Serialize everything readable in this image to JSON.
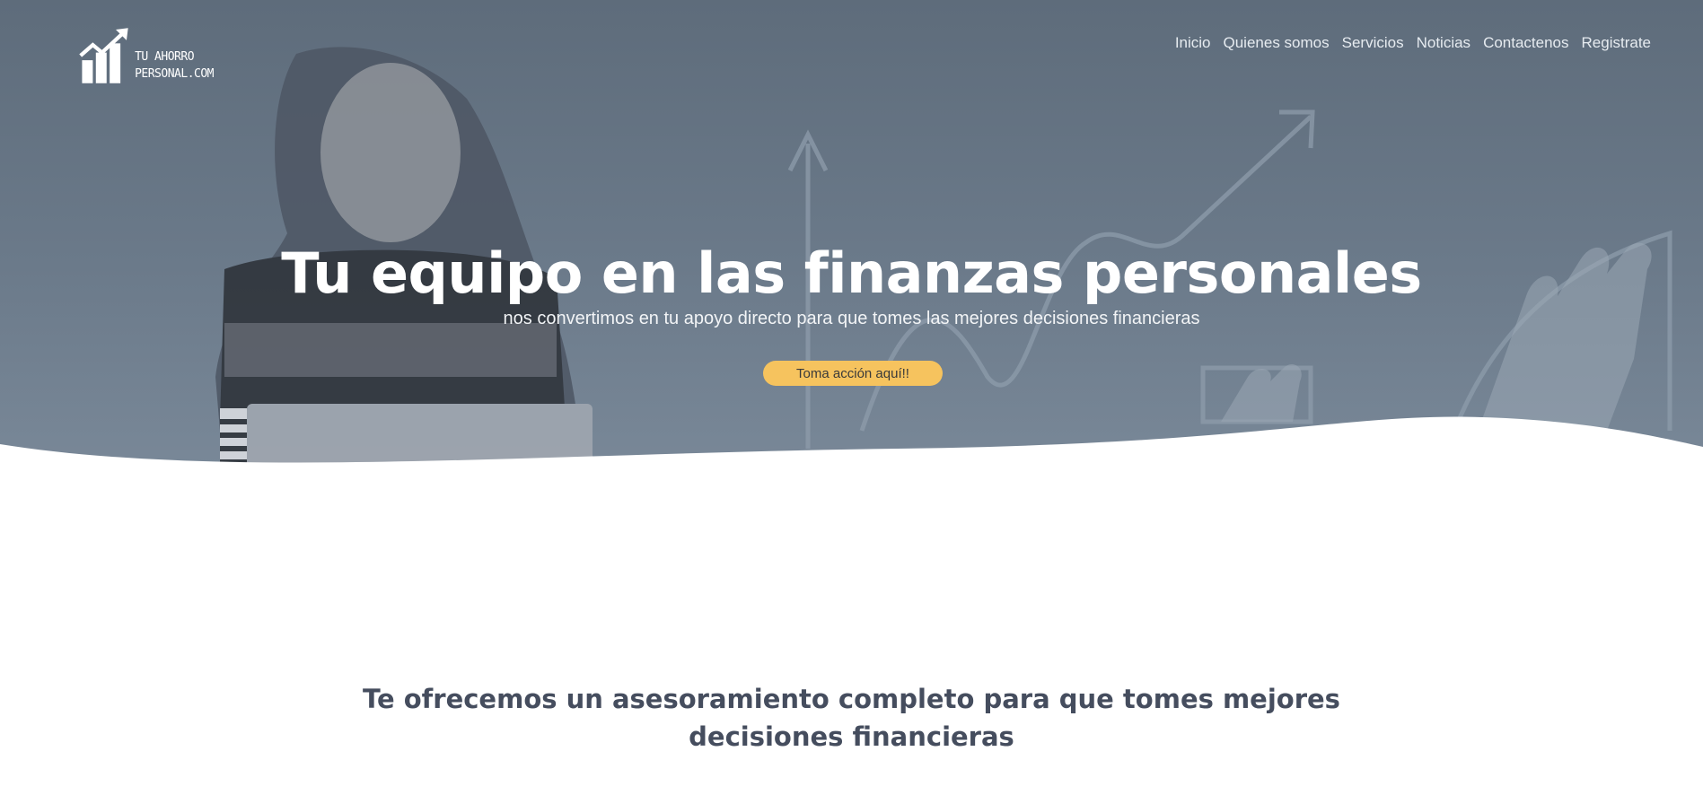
{
  "brand": {
    "logo_line1": "TU AHORRO",
    "logo_line2": "PERSONAL.COM"
  },
  "nav": {
    "items": [
      {
        "label": "Inicio"
      },
      {
        "label": "Quienes somos"
      },
      {
        "label": "Servicios"
      },
      {
        "label": "Noticias"
      },
      {
        "label": "Contactenos"
      },
      {
        "label": "Registrate"
      }
    ]
  },
  "hero": {
    "title": "Tu equipo en las finanzas personales",
    "subtitle": "nos convertimos en tu apoyo directo para que tomes las mejores decisiones financieras",
    "cta_label": "Toma acción aquí!!",
    "overlay_color": "#5e6c7b",
    "cta_color": "#f6c35e"
  },
  "services": {
    "title": "Te ofrecemos un asesoramiento completo para que tomes mejores decisiones financieras"
  }
}
